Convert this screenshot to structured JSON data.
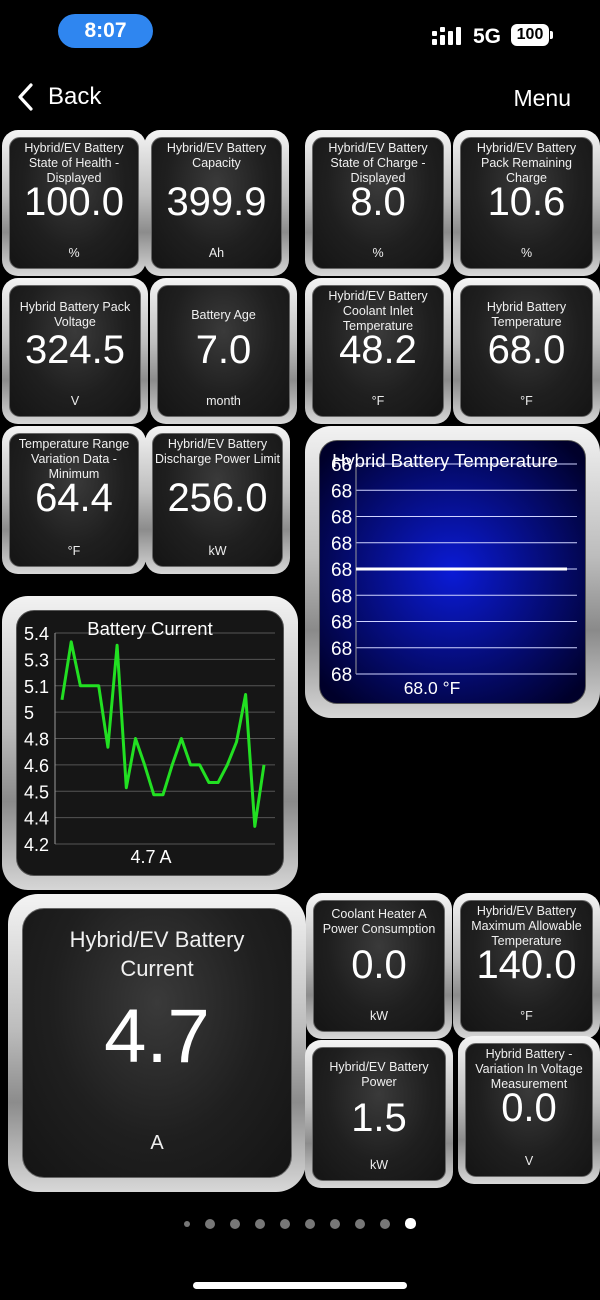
{
  "status_bar": {
    "time": "8:07",
    "network": "5G",
    "battery": "100"
  },
  "nav": {
    "back_label": "Back",
    "menu_label": "Menu"
  },
  "gauges": [
    {
      "name": "Hybrid/EV Battery State of Health - Displayed",
      "value": "100.0",
      "unit": "%"
    },
    {
      "name": "Hybrid/EV Battery Capacity",
      "value": "399.9",
      "unit": "Ah"
    },
    {
      "name": "Hybrid/EV Battery State of Charge - Displayed",
      "value": "8.0",
      "unit": "%"
    },
    {
      "name": "Hybrid/EV Battery Pack Remaining Charge",
      "value": "10.6",
      "unit": "%"
    },
    {
      "name": "Hybrid Battery Pack Voltage",
      "value": "324.5",
      "unit": "V"
    },
    {
      "name": "Battery Age",
      "value": "7.0",
      "unit": "month"
    },
    {
      "name": "Hybrid/EV Battery Coolant Inlet Temperature",
      "value": "48.2",
      "unit": "°F"
    },
    {
      "name": "Hybrid Battery Temperature",
      "value": "68.0",
      "unit": "°F"
    },
    {
      "name": "Temperature Range Variation Data - Minimum",
      "value": "64.4",
      "unit": "°F"
    },
    {
      "name": "Hybrid/EV Battery Discharge Power Limit",
      "value": "256.0",
      "unit": "kW"
    },
    {
      "name": "Hybrid/EV Battery Current",
      "value": "4.7",
      "unit": "A"
    },
    {
      "name": "Coolant Heater A Power Consumption",
      "value": "0.0",
      "unit": "kW"
    },
    {
      "name": "Hybrid/EV Battery Maximum Allowable Temperature",
      "value": "140.0",
      "unit": "°F"
    },
    {
      "name": "Hybrid/EV Battery Power",
      "value": "1.5",
      "unit": "kW"
    },
    {
      "name": "Hybrid Battery - Variation In Voltage Measurement",
      "value": "0.0",
      "unit": "V"
    }
  ],
  "chart_data": [
    {
      "type": "line",
      "title": "Hybrid Battery Temperature",
      "readout": "68.0 °F",
      "y_tick_labels": [
        "68",
        "68",
        "68",
        "68",
        "68",
        "68",
        "68",
        "68",
        "68"
      ],
      "x": [
        0,
        1
      ],
      "series": [
        {
          "values": [
            68.0,
            68.0
          ]
        }
      ],
      "ylim": [
        67.9,
        68.1
      ],
      "grid": true,
      "line_color": "#ffffff",
      "background_color": "#0b1bd6"
    },
    {
      "type": "line",
      "title": "Battery Current",
      "readout": "4.7 A",
      "y_tick_labels": [
        "5.4",
        "5.3",
        "5.1",
        "5",
        "4.8",
        "4.6",
        "4.5",
        "4.4",
        "4.2"
      ],
      "ylim": [
        4.2,
        5.4
      ],
      "grid": true,
      "line_color": "#22e022",
      "x": [
        0,
        1,
        2,
        3,
        4,
        5,
        6,
        7,
        8,
        9,
        10,
        11,
        12,
        13,
        14,
        15,
        16,
        17,
        18,
        19,
        20,
        21,
        22
      ],
      "series": [
        {
          "values": [
            5.02,
            5.35,
            5.1,
            5.1,
            5.1,
            4.75,
            5.33,
            4.52,
            4.8,
            4.65,
            4.48,
            4.48,
            4.65,
            4.8,
            4.65,
            4.65,
            4.55,
            4.55,
            4.65,
            4.78,
            5.05,
            4.3,
            4.65
          ]
        }
      ]
    }
  ],
  "pagination": {
    "count": 10,
    "active": 9
  }
}
